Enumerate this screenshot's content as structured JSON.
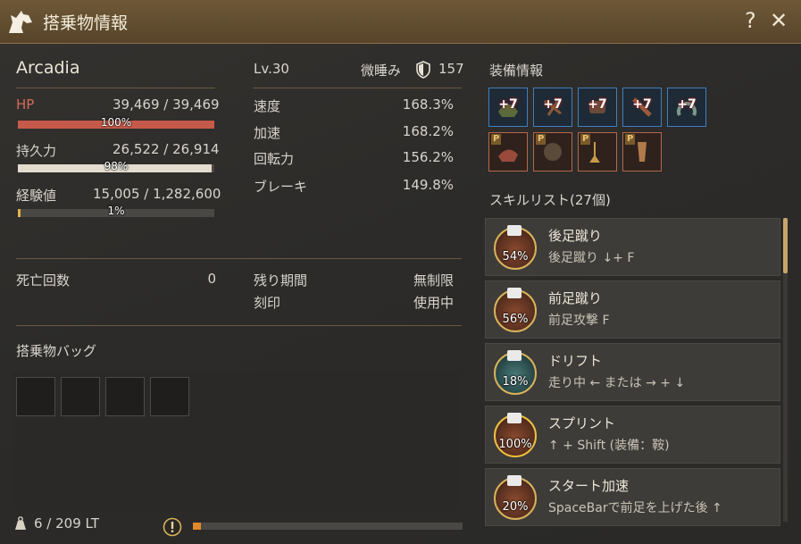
{
  "window": {
    "title": "搭乗物情報",
    "help_label": "?",
    "close_label": "✕",
    "title_icon": "horse-head-icon"
  },
  "mount": {
    "name": "Arcadia",
    "level": "Lv.30",
    "state": "微睡み",
    "armor_icon": "shield-icon",
    "defense": "157"
  },
  "stats": {
    "hp": {
      "label": "HP",
      "value": "39,469 / 39,469",
      "pct": "100%",
      "fraction": 1.0,
      "color": "#c65a4a"
    },
    "stamina": {
      "label": "持久力",
      "value": "26,522 / 26,914",
      "pct": "98%",
      "fraction": 0.985,
      "color": "#e4ddcf"
    },
    "exp": {
      "label": "経験値",
      "value": "15,005 / 1,282,600",
      "pct": "1%",
      "fraction": 0.012,
      "color": "#e0b34a"
    }
  },
  "movement": [
    {
      "label": "速度",
      "value": "168.3%"
    },
    {
      "label": "加速",
      "value": "168.2%"
    },
    {
      "label": "回転力",
      "value": "156.2%"
    },
    {
      "label": "ブレーキ",
      "value": "149.8%"
    }
  ],
  "deaths": {
    "label": "死亡回数",
    "value": "0"
  },
  "period": {
    "label": "残り期間",
    "value": "無制限"
  },
  "seal": {
    "label": "刻印",
    "value": "使用中"
  },
  "bag": {
    "title": "搭乗物バッグ",
    "weight": "6 / 209 LT",
    "weight_icon": "weight-icon",
    "alert_icon": "exclamation-icon",
    "load_fraction": 0.03
  },
  "equipment": {
    "title": "装備情報",
    "row1": [
      "+7",
      "+7",
      "+7",
      "+7",
      "+7"
    ],
    "row2_tag": "P"
  },
  "skills": {
    "title": "スキルリスト(27個)",
    "items": [
      {
        "name": "後足蹴り",
        "cmd": "後足蹴り ↓+ F",
        "pct": "54%"
      },
      {
        "name": "前足蹴り",
        "cmd": "前足攻撃 F",
        "pct": "56%"
      },
      {
        "name": "ドリフト",
        "cmd": "走り中 ← または → + ↓",
        "pct": "18%"
      },
      {
        "name": "スプリント",
        "cmd": "↑ + Shift (装備：鞍)",
        "pct": "100%"
      },
      {
        "name": "スタート加速",
        "cmd": "SpaceBarで前足を上げた後 ↑",
        "pct": "20%"
      }
    ]
  }
}
